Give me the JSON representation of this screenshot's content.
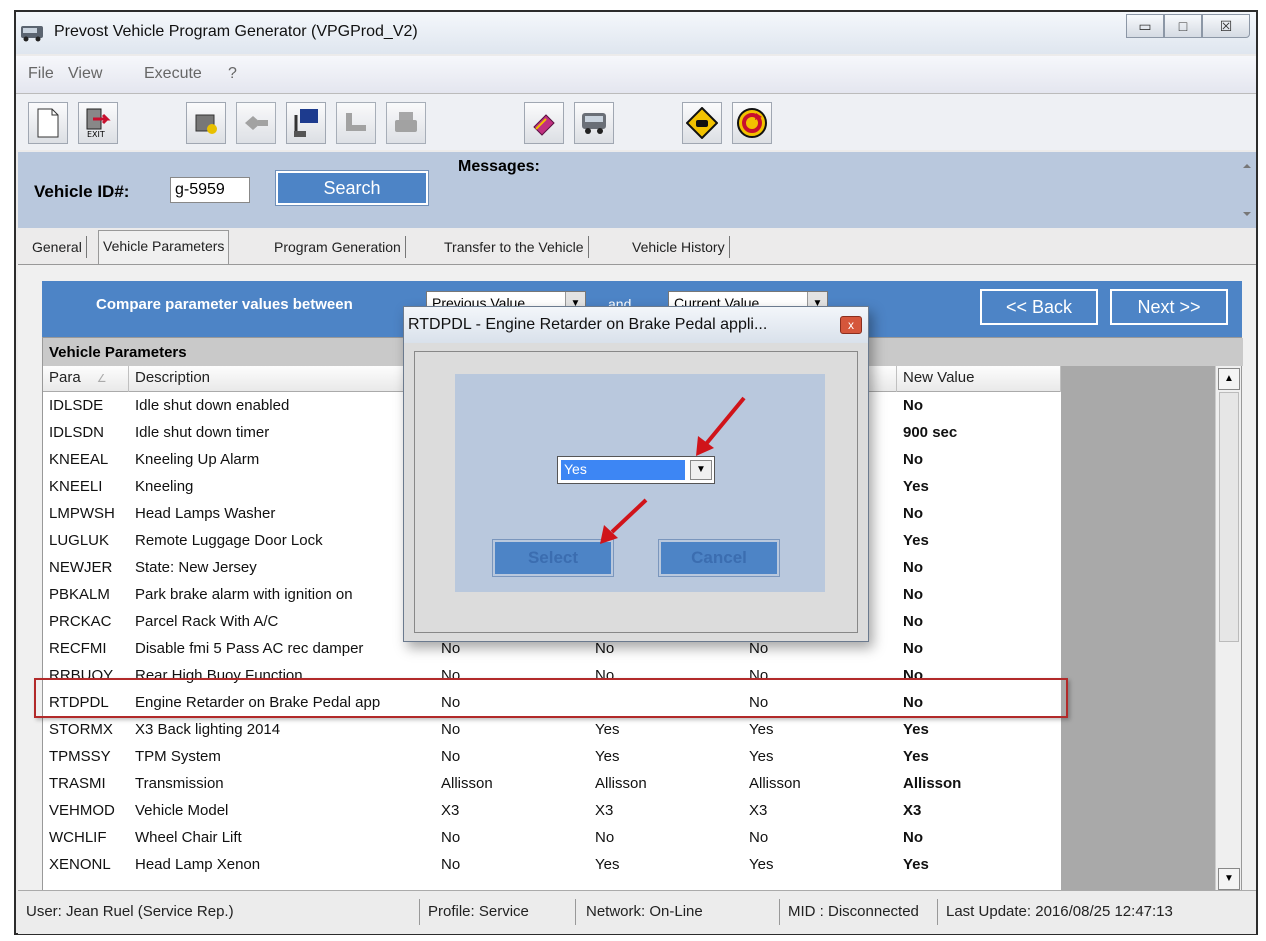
{
  "window": {
    "title": "Prevost Vehicle Program Generator  (VPGProd_V2)",
    "controls": [
      "▭",
      "□",
      "☒"
    ]
  },
  "menu": [
    "File",
    "View",
    "Execute",
    "?"
  ],
  "toolbar": {
    "buttons": [
      "new-document-icon",
      "exit-icon",
      "program-icon",
      "connect-icon",
      "download-icon",
      "seat-icon",
      "print-icon",
      "book-icon",
      "bus-icon",
      "road-sign-icon",
      "refresh-icon"
    ]
  },
  "search": {
    "label": "Vehicle ID#:",
    "value": "g-5959",
    "button": "Search",
    "messages_label": "Messages:"
  },
  "tabs": [
    "General",
    "Vehicle Parameters",
    "Program Generation",
    "Transfer to the Vehicle",
    "Vehicle History"
  ],
  "compare": {
    "label": "Compare parameter values between",
    "left": "Previous Value",
    "and": "and",
    "right": "Current Value",
    "back": "<< Back",
    "next": "Next >>"
  },
  "grid": {
    "group": "Vehicle Parameters",
    "headers": [
      "Para",
      "Description",
      "",
      "",
      "",
      "New Value"
    ],
    "rows": [
      [
        "IDLSDE",
        "Idle shut down enabled",
        "",
        "",
        "",
        "No"
      ],
      [
        "IDLSDN",
        "Idle shut down timer",
        "",
        "",
        "",
        "900 sec"
      ],
      [
        "KNEEAL",
        "Kneeling Up Alarm",
        "",
        "",
        "",
        "No"
      ],
      [
        "KNEELI",
        "Kneeling",
        "",
        "",
        "",
        "Yes"
      ],
      [
        "LMPWSH",
        "Head Lamps Washer",
        "",
        "",
        "",
        "No"
      ],
      [
        "LUGLUK",
        "Remote Luggage Door Lock",
        "",
        "",
        "",
        "Yes"
      ],
      [
        "NEWJER",
        "State: New Jersey",
        "",
        "",
        "",
        "No"
      ],
      [
        "PBKALM",
        "Park brake alarm with ignition on",
        "",
        "",
        "",
        "No"
      ],
      [
        "PRCKAC",
        "Parcel Rack With A/C",
        "",
        "",
        "",
        "No"
      ],
      [
        "RECFMI",
        "Disable fmi 5 Pass AC rec damper",
        "No",
        "No",
        "No",
        "No"
      ],
      [
        "RRBUOY",
        "Rear High Buoy Function",
        "No",
        "No",
        "No",
        "No"
      ],
      [
        "RTDPDL",
        "Engine Retarder on Brake Pedal app",
        "No",
        "",
        "No",
        "No"
      ],
      [
        "STORMX",
        "X3 Back lighting 2014",
        "No",
        "Yes",
        "Yes",
        "Yes"
      ],
      [
        "TPMSSY",
        "TPM System",
        "No",
        "Yes",
        "Yes",
        "Yes"
      ],
      [
        "TRASMI",
        "Transmission",
        "Allisson",
        "Allisson",
        "Allisson",
        "Allisson"
      ],
      [
        "VEHMOD",
        "Vehicle Model",
        "X3",
        "X3",
        "X3",
        "X3"
      ],
      [
        "WCHLIF",
        "Wheel Chair Lift",
        "No",
        "No",
        "No",
        "No"
      ],
      [
        "XENONL",
        "Head Lamp Xenon",
        "No",
        "Yes",
        "Yes",
        "Yes"
      ]
    ]
  },
  "status": {
    "user": "User: Jean Ruel (Service Rep.)",
    "profile": "Profile: Service",
    "network": "Network: On-Line",
    "mid": "MID : Disconnected",
    "last_update": "Last Update: 2016/08/25 12:47:13"
  },
  "dialog": {
    "title": "RTDPDL - Engine Retarder on Brake Pedal appli...",
    "close": "x",
    "selected": "Yes",
    "select": "Select",
    "cancel": "Cancel"
  },
  "colors": {
    "accent": "#4d84c6",
    "panel": "#b9c8dd",
    "highlight": "#b22a2a",
    "selection": "#3d86f4"
  }
}
